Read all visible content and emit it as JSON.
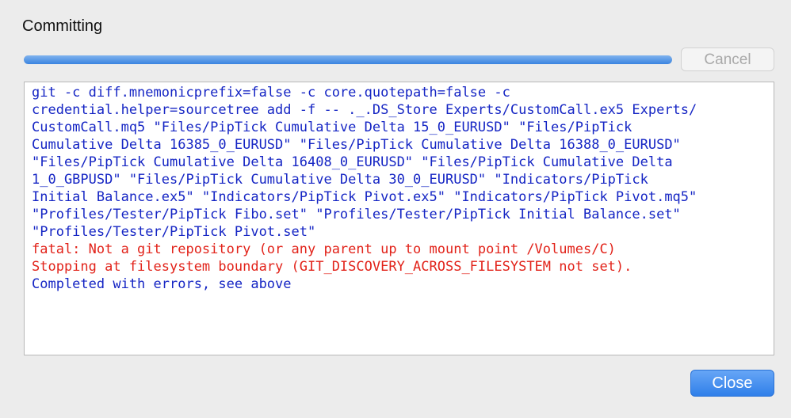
{
  "dialog": {
    "title": "Committing",
    "progress_percent": 100,
    "cancel_label": "Cancel",
    "close_label": "Close"
  },
  "log": {
    "lines": [
      {
        "text": "git -c diff.mnemonicprefix=false -c core.quotepath=false -c",
        "type": "info"
      },
      {
        "text": "credential.helper=sourcetree add -f -- ._.DS_Store Experts/CustomCall.ex5 Experts/",
        "type": "info"
      },
      {
        "text": "CustomCall.mq5 \"Files/PipTick Cumulative Delta 15_0_EURUSD\" \"Files/PipTick",
        "type": "info"
      },
      {
        "text": "Cumulative Delta 16385_0_EURUSD\" \"Files/PipTick Cumulative Delta 16388_0_EURUSD\"",
        "type": "info"
      },
      {
        "text": "\"Files/PipTick Cumulative Delta 16408_0_EURUSD\" \"Files/PipTick Cumulative Delta",
        "type": "info"
      },
      {
        "text": "1_0_GBPUSD\" \"Files/PipTick Cumulative Delta 30_0_EURUSD\" \"Indicators/PipTick",
        "type": "info"
      },
      {
        "text": "Initial Balance.ex5\" \"Indicators/PipTick Pivot.ex5\" \"Indicators/PipTick Pivot.mq5\"",
        "type": "info"
      },
      {
        "text": "\"Profiles/Tester/PipTick Fibo.set\" \"Profiles/Tester/PipTick Initial Balance.set\"",
        "type": "info"
      },
      {
        "text": "\"Profiles/Tester/PipTick Pivot.set\"",
        "type": "info"
      },
      {
        "text": "fatal: Not a git repository (or any parent up to mount point /Volumes/C)",
        "type": "error"
      },
      {
        "text": "Stopping at filesystem boundary (GIT_DISCOVERY_ACROSS_FILESYSTEM not set).",
        "type": "error"
      },
      {
        "text": "Completed with errors, see above",
        "type": "info"
      }
    ]
  },
  "colors": {
    "info_text": "#1525c4",
    "error_text": "#e2231a",
    "accent": "#2f7fe9"
  }
}
